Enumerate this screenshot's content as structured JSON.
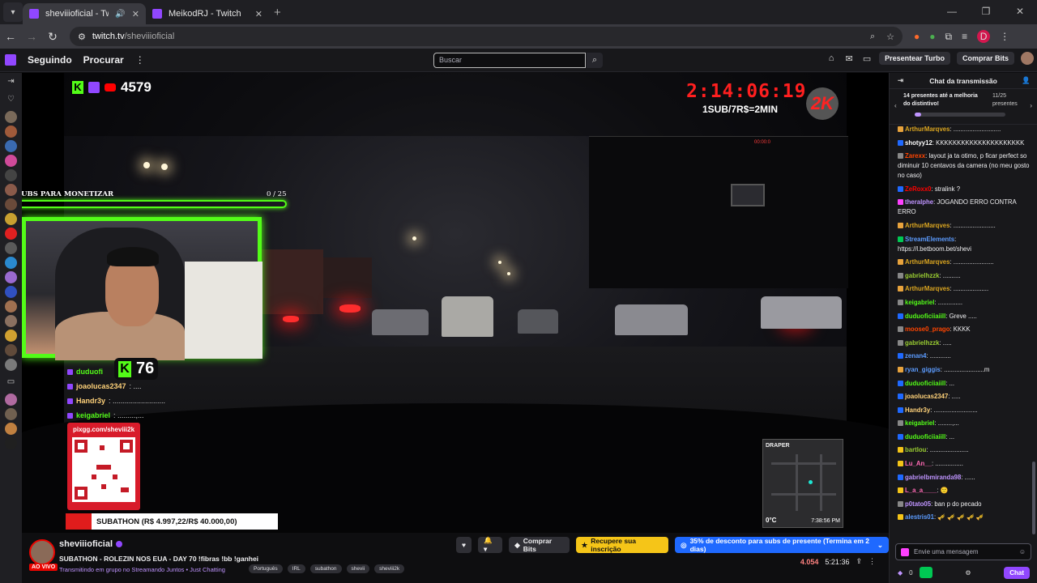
{
  "browser": {
    "tabs": [
      {
        "title": "sheviiioficial - Twitch",
        "active": true,
        "audio": true
      },
      {
        "title": "MeikodRJ - Twitch",
        "active": false,
        "audio": false
      }
    ],
    "url_host": "twitch.tv",
    "url_path": "/sheviiioficial",
    "profile_initial": "D"
  },
  "topnav": {
    "following": "Seguindo",
    "browse": "Procurar",
    "search_placeholder": "Buscar",
    "turbo": "Presentear Turbo",
    "bits": "Comprar Bits"
  },
  "overlay": {
    "k_count": "4579",
    "timer": "2:14:06:19",
    "sub_rate": "1SUB/7R$=2MIN",
    "brand": "2K",
    "subs_label": "SUBS PARA MONETIZAR",
    "subs_count": "0  / 25",
    "kick_followers": "76",
    "chat": [
      {
        "name": "duduofi",
        "msg": "",
        "color": "#53fc18"
      },
      {
        "name": "joaolucas2347",
        "msg": ": ....",
        "color": "#ffd27a"
      },
      {
        "name": "Handr3y",
        "msg": ": ..........................",
        "color": "#ffd27a"
      },
      {
        "name": "keigabriel",
        "msg": ": .........,...",
        "color": "#53fc18"
      }
    ],
    "qr_url": "pixgg.com/sheviii2k",
    "subathon": "SUBATHON (R$ 4.997,22/R$ 40.000,00)",
    "map_label": "DRAPER",
    "temperature": "0°C",
    "clock": "7:38:56 PM",
    "pip_rec": "00:00:0"
  },
  "info": {
    "channel": "sheviiioficial",
    "live": "AO VIVO",
    "title": "SUBATHON - ROLEZIN NOS EUA - DAY 70 !fibras !bb !ganhei",
    "game": "Transmitindo em grupo no Streamando Juntos • Just Chatting",
    "tags": [
      "Português",
      "IRL",
      "subathon",
      "shevii",
      "sheviii2k"
    ],
    "bits_btn": "Comprar Bits",
    "recover_btn": "Recupere sua inscrição",
    "promo_btn": "35% de desconto para subs de presente (Termina em 2 dias)",
    "viewers": "4.054",
    "uptime": "5:21:36"
  },
  "chat": {
    "header": "Chat da transmissão",
    "gift_text": "14 presentes até a melhoria do distintivo!",
    "gift_count": "11/25 presentes",
    "gift_progress": 0.07,
    "input_placeholder": "Envie uma mensagem",
    "points": "0",
    "chat_button": "Chat",
    "messages": [
      {
        "name": "ArthurMarqves",
        "msg": ": ...........................",
        "color": "#daa520",
        "badge": "#e8a33d"
      },
      {
        "name": "shotyy12",
        "msg": ": KKKKKKKKKKKKKKKKKKKKK",
        "color": "#ffffff",
        "badge": "#1f69ff"
      },
      {
        "name": "Zarexx",
        "msg": ": layout ja ta otimo, p ficar perfect so diminuir 10 centavos da camera (no meu gosto no caso)",
        "color": "#ff4500",
        "badge": "#888888"
      },
      {
        "name": "ZeRoxx0",
        "msg": ": stralink ?",
        "color": "#ff0000",
        "badge": "#1f69ff"
      },
      {
        "name": "theralphe",
        "msg": ": JOGANDO ERRO CONTRA ERRO",
        "color": "#bf94ff",
        "badge": "#ff40ff"
      },
      {
        "name": "ArthurMarqves",
        "msg": ": ........................",
        "color": "#daa520",
        "badge": "#e8a33d"
      },
      {
        "name": "StreamElements",
        "msg": ": https://l.betboom.bet/shevi",
        "color": "#5c9cff",
        "badge": "#00c853"
      },
      {
        "name": "ArthurMarqves",
        "msg": ": .......................",
        "color": "#daa520",
        "badge": "#e8a33d"
      },
      {
        "name": "gabrielhzzk",
        "msg": ": ..........",
        "color": "#9acd32",
        "badge": "#888888"
      },
      {
        "name": "ArthurMarqves",
        "msg": ": ....................",
        "color": "#daa520",
        "badge": "#e8a33d"
      },
      {
        "name": "keigabriel",
        "msg": ": ..............",
        "color": "#53fc18",
        "badge": "#888888"
      },
      {
        "name": "duduoficiiaiill",
        "msg": ": Greve .....",
        "color": "#53fc18",
        "badge": "#1f69ff"
      },
      {
        "name": "moose0_prago",
        "msg": ": KKKK",
        "color": "#ff4500",
        "badge": "#888888"
      },
      {
        "name": "gabrielhzzk",
        "msg": ": .....",
        "color": "#9acd32",
        "badge": "#888888"
      },
      {
        "name": "zenan4",
        "msg": ": ............",
        "color": "#5c9cff",
        "badge": "#1f69ff"
      },
      {
        "name": "ryan_giggis",
        "msg": ": .......................m",
        "color": "#5c9cff",
        "badge": "#e8a33d"
      },
      {
        "name": "duduoficiiaiill",
        "msg": ": ...",
        "color": "#53fc18",
        "badge": "#1f69ff"
      },
      {
        "name": "joaolucas2347",
        "msg": ": .....",
        "color": "#ffd27a",
        "badge": "#1f69ff"
      },
      {
        "name": "Handr3y",
        "msg": ": .........................",
        "color": "#ffd27a",
        "badge": "#1f69ff"
      },
      {
        "name": "keigabriel",
        "msg": ": ........,...",
        "color": "#53fc18",
        "badge": "#888888"
      },
      {
        "name": "duduoficiiaiill",
        "msg": ": ...",
        "color": "#53fc18",
        "badge": "#1f69ff"
      },
      {
        "name": "bartlou",
        "msg": ": ......................",
        "color": "#9acd32",
        "badge": "#f5c518"
      },
      {
        "name": "Lu_An__",
        "msg": ": ................",
        "color": "#ff69b4",
        "badge": "#f5c518"
      },
      {
        "name": "gabrielbmiranda98",
        "msg": ": ......",
        "color": "#bf94ff",
        "badge": "#1f69ff"
      },
      {
        "name": "L_a_a____",
        "msg": ": 🙂",
        "color": "#ff69b4",
        "badge": "#f5c518"
      },
      {
        "name": "p0tato05",
        "msg": ": ban p do pecado",
        "color": "#bf94ff",
        "badge": "#888888"
      },
      {
        "name": "alestris01",
        "msg": ": 🎺 🎺 🎺 🎺 🎺",
        "color": "#5c9cff",
        "badge": "#f5c518"
      }
    ]
  }
}
